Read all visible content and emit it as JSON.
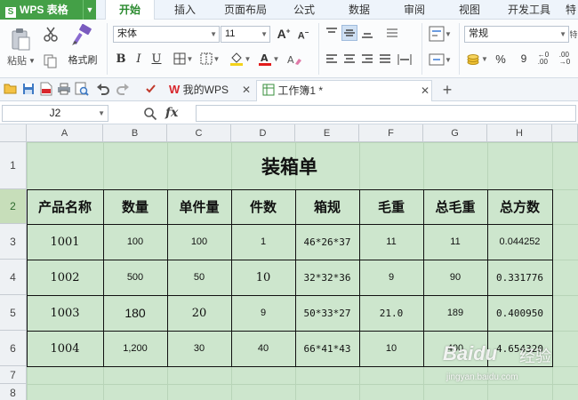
{
  "app": {
    "name": "WPS 表格",
    "logo_letter": "S"
  },
  "menu": {
    "tabs": [
      "开始",
      "插入",
      "页面布局",
      "公式",
      "数据",
      "审阅",
      "视图",
      "开发工具",
      "特"
    ],
    "active": "开始"
  },
  "ribbon": {
    "paste_label": "粘贴",
    "format_painter_label": "格式刷",
    "font_name": "宋体",
    "font_size": "11",
    "number_format": "常规",
    "percent_label": "%",
    "thousands_label": "9"
  },
  "doc_tabs": [
    {
      "label": "我的WPS",
      "logo": "W"
    },
    {
      "label": "工作簿1 *"
    }
  ],
  "formula_bar": {
    "cell_ref": "J2",
    "fx": "fx",
    "content": ""
  },
  "sheet": {
    "columns": [
      "A",
      "B",
      "C",
      "D",
      "E",
      "F",
      "G",
      "H"
    ],
    "rows": [
      "1",
      "2",
      "3",
      "4",
      "5",
      "6",
      "7",
      "8"
    ],
    "title": "装箱单",
    "headers": [
      "产品名称",
      "数量",
      "单件量",
      "件数",
      "箱规",
      "毛重",
      "总毛重",
      "总方数"
    ],
    "data": [
      [
        "1001",
        "100",
        "100",
        "1",
        "46*26*37",
        "11",
        "11",
        "0.044252"
      ],
      [
        "1002",
        "500",
        "50",
        "10",
        "32*32*36",
        "9",
        "90",
        "0.331776"
      ],
      [
        "1003",
        "180",
        "20",
        "9",
        "50*33*27",
        "21.0",
        "189",
        "0.400950"
      ],
      [
        "1004",
        "1,200",
        "30",
        "40",
        "66*41*43",
        "10",
        "400",
        "4.654320"
      ]
    ]
  },
  "watermark": {
    "logo": "Baidu",
    "text": "经验",
    "url": "jingyan.baidu.com"
  },
  "colors": {
    "accent": "#44a047",
    "sheet_bg": "#cde6cd",
    "grid": "#b8d4b8"
  }
}
